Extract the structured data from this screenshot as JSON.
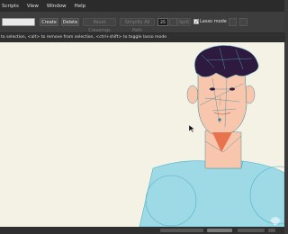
{
  "menu": {
    "items": [
      "Scripts",
      "View",
      "Window",
      "Help"
    ]
  },
  "toolbar": {
    "name_value": "",
    "create_label": "Create",
    "delete_label": "Delete",
    "reset_label": "Reset Creasings",
    "simplify_label": "Simplify All Path",
    "simplify_value": "25",
    "split_label": "Split",
    "lasso_label": "Lasso mode",
    "lasso_checked": true
  },
  "hint": {
    "text": "to selection, <alt> to remove from selection, <ctrl+shift> to toggle lasso mode"
  },
  "colors": {
    "skin": "#f7c6ad",
    "shirt": "#9ed9e6",
    "shirt_outline": "#4fb3c6",
    "hair": "#2d1a3e",
    "mouth": "#e8734f",
    "mesh": "#2b7f8e",
    "canvas": "#f4f1e5"
  },
  "canvas": {
    "cursor_icon": "arrow-cursor-icon",
    "watermark_icon": "watermark-logo-icon"
  }
}
